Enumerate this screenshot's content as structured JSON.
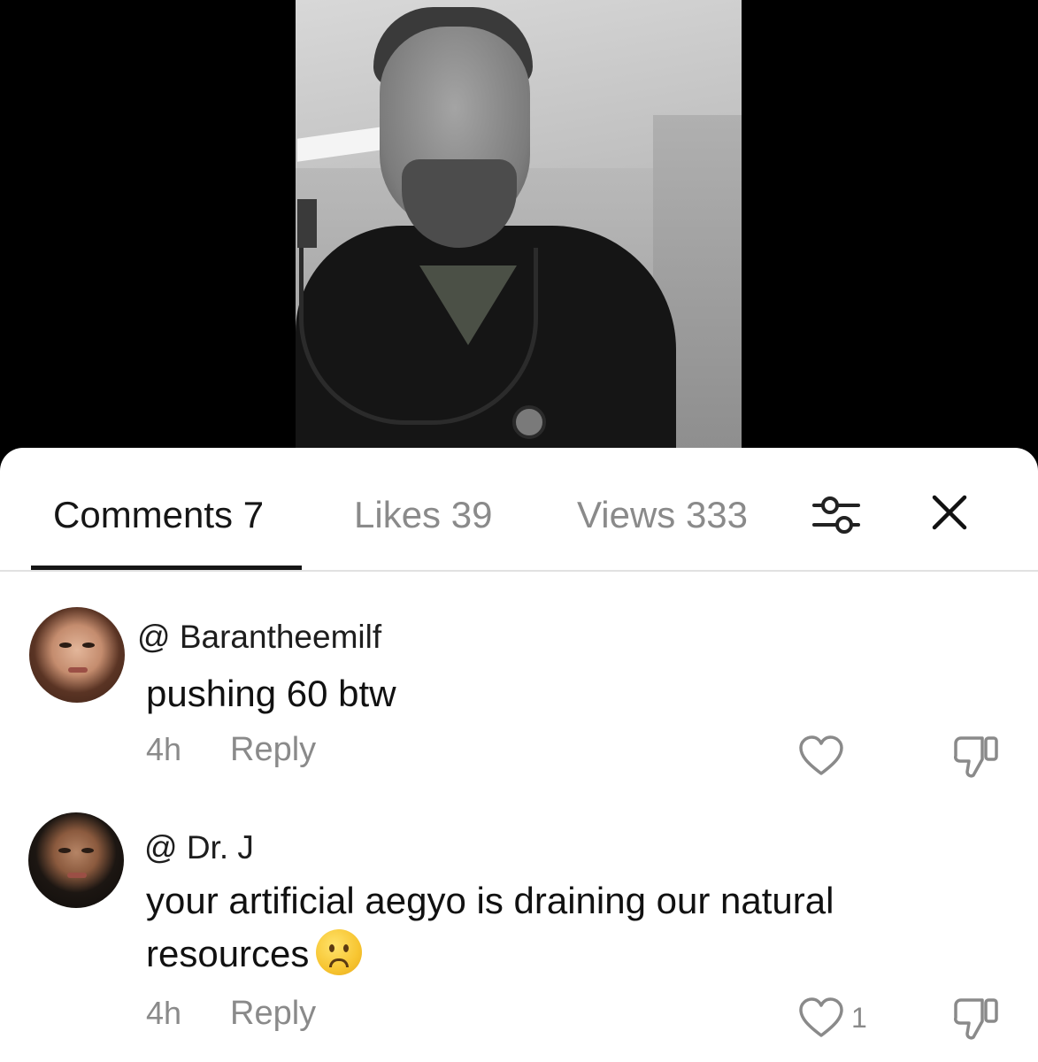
{
  "video": {
    "image_description": "photo of smiling bearded man in black scrubs with stethoscope"
  },
  "tabs": [
    {
      "label": "Comments 7",
      "active": true
    },
    {
      "label": "Likes 39",
      "active": false
    },
    {
      "label": "Views 333",
      "active": false
    }
  ],
  "toolbar": {
    "filter_icon": "sliders-icon",
    "close_icon": "close-icon"
  },
  "comments": [
    {
      "username": "@ Barantheemilf",
      "text": "pushing 60 btw",
      "time": "4h",
      "reply_label": "Reply",
      "like_count": ""
    },
    {
      "username": "@ Dr. J",
      "text": "your artificial aegyo is draining our natural resources",
      "emoji": "slightly-frowning-face",
      "time": "4h",
      "reply_label": "Reply",
      "like_count": "1"
    }
  ],
  "colors": {
    "active_tab": "#161616",
    "inactive_tab": "#8a8a8a",
    "sheet_bg": "#ffffff",
    "backdrop": "#000000"
  }
}
